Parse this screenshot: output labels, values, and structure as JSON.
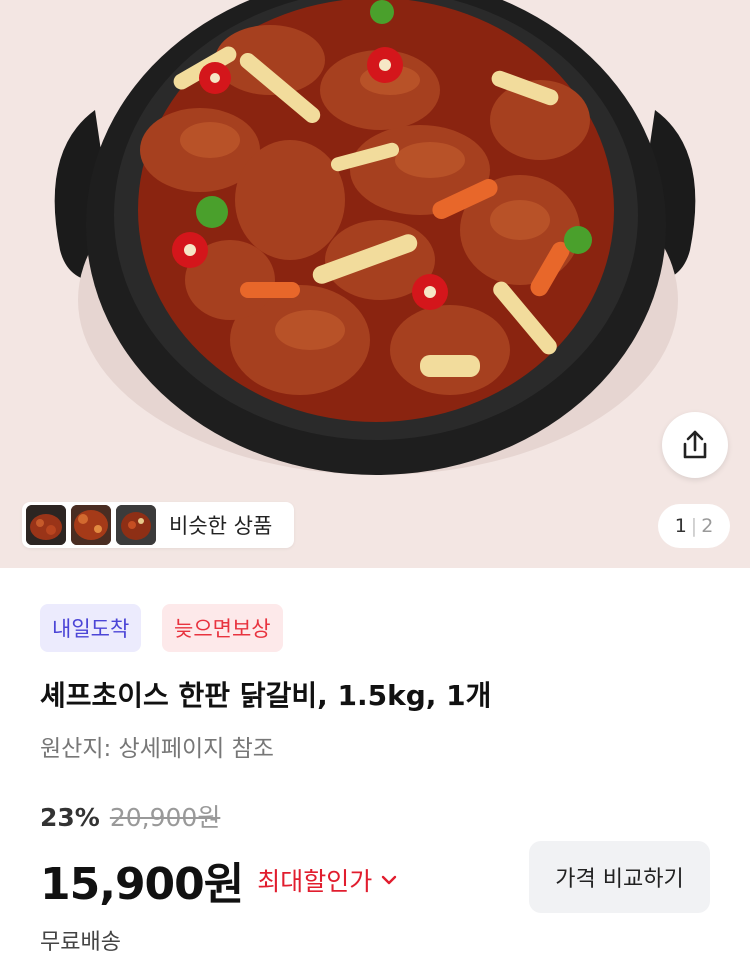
{
  "gallery": {
    "image_icon": "food-photo-dakgalbi",
    "share_icon": "share-icon",
    "similar_products_label": "비슷한 상품",
    "pager_current": "1",
    "pager_separator": "|",
    "pager_total": "2"
  },
  "badges": {
    "arrival": "내일도착",
    "late_compensation": "늦으면보상"
  },
  "product": {
    "title": "셰프초이스 한판 닭갈비, 1.5kg, 1개",
    "origin": "원산지: 상세페이지 참조"
  },
  "price": {
    "discount_rate": "23%",
    "original_price": "20,900원",
    "sale_price": "15,900원",
    "max_discount_label": "최대할인가",
    "max_discount_icon": "chevron-down-icon",
    "compare_button": "가격 비교하기",
    "shipping": "무료배송"
  },
  "colors": {
    "hero_background": "#f3e6e3",
    "arrival_badge_bg": "#ecebfd",
    "arrival_badge_text": "#4b45d6",
    "comp_badge_bg": "#fde9ea",
    "comp_badge_text": "#e8333f",
    "max_discount_text": "#e11d2e"
  }
}
